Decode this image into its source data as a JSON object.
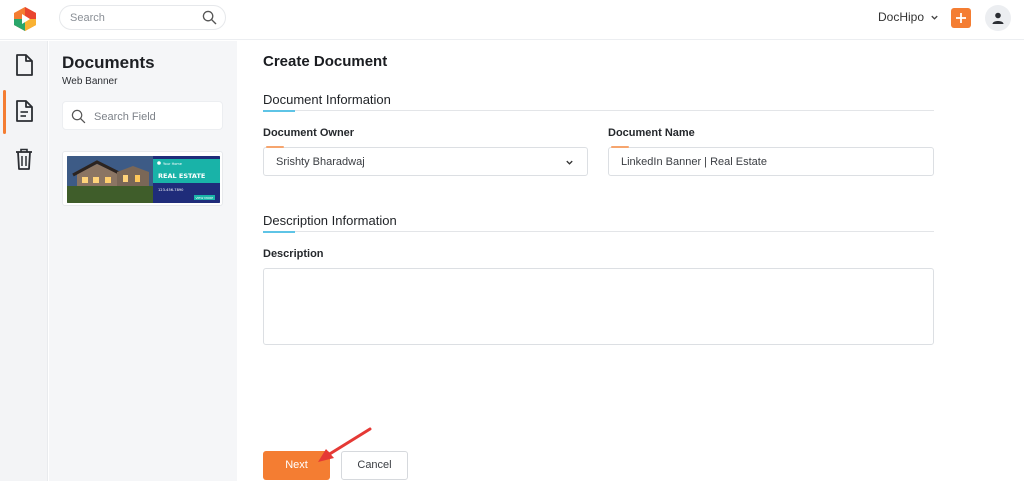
{
  "topbar": {
    "search_placeholder": "Search",
    "brand_name": "DocHipo",
    "logo_icon": "dochipo-logo-icon",
    "add_icon": "plus-icon",
    "user_icon": "user-icon"
  },
  "rail": {
    "items": [
      {
        "icon": "document-icon",
        "active": false
      },
      {
        "icon": "document-lines-icon",
        "active": true
      },
      {
        "icon": "trash-icon",
        "active": false
      }
    ]
  },
  "docpanel": {
    "title": "Documents",
    "subtitle": "Web Banner",
    "search_placeholder": "Search Field",
    "thumbnail": {
      "headline": "REAL ESTATE",
      "tagline": "Your Home",
      "button": "VIEW MORE",
      "phone": "123-456-7890"
    }
  },
  "form": {
    "title": "Create Document",
    "document_info": {
      "heading": "Document Information",
      "owner_label": "Document Owner",
      "owner_value": "Srishty Bharadwaj",
      "name_label": "Document Name",
      "name_value": "LinkedIn Banner | Real Estate"
    },
    "description_info": {
      "heading": "Description Information",
      "description_label": "Description",
      "description_value": ""
    },
    "next_label": "Next",
    "cancel_label": "Cancel"
  },
  "colors": {
    "accent": "#f47d32",
    "section_accent": "#5ec4e6",
    "annotation_arrow": "#e53935"
  }
}
